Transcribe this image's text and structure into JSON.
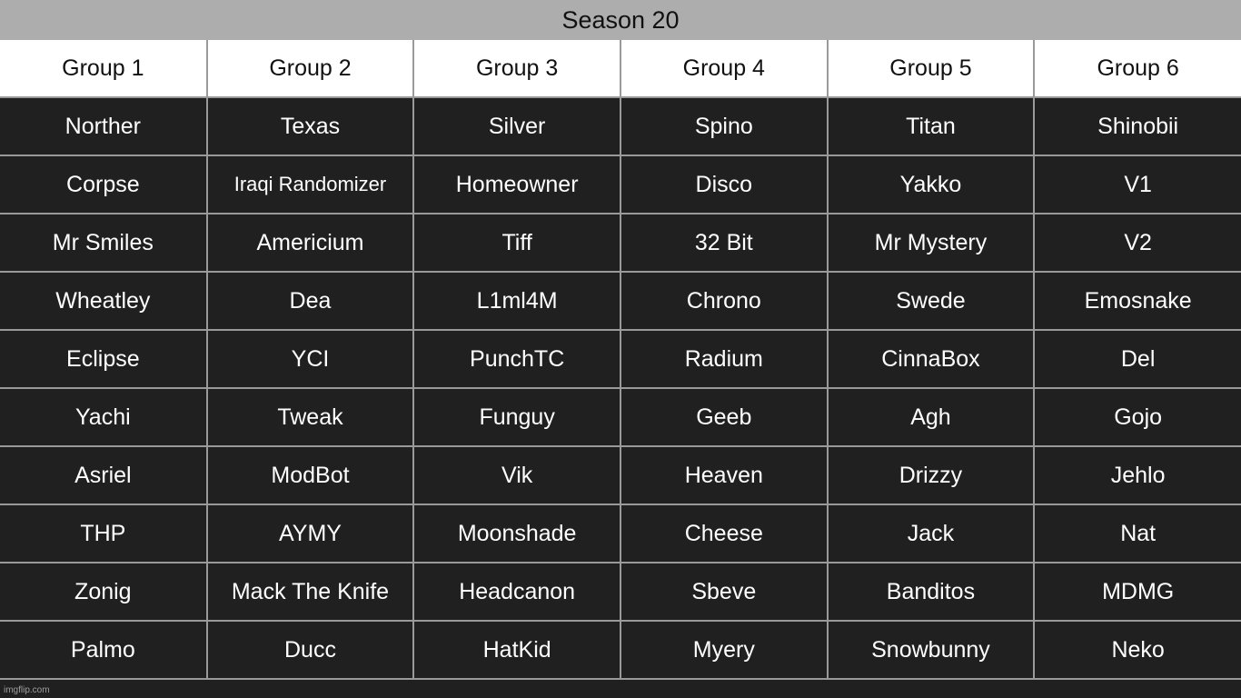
{
  "title": "Season 20",
  "headers": [
    "Group 1",
    "Group 2",
    "Group 3",
    "Group 4",
    "Group 5",
    "Group 6"
  ],
  "rows": [
    [
      "Norther",
      "Texas",
      "Silver",
      "Spino",
      "Titan",
      "Shinobii"
    ],
    [
      "Corpse",
      "Iraqi Randomizer",
      "Homeowner",
      "Disco",
      "Yakko",
      "V1"
    ],
    [
      "Mr Smiles",
      "Americium",
      "Tiff",
      "32 Bit",
      "Mr Mystery",
      "V2"
    ],
    [
      "Wheatley",
      "Dea",
      "L1ml4M",
      "Chrono",
      "Swede",
      "Emosnake"
    ],
    [
      "Eclipse",
      "YCI",
      "PunchTC",
      "Radium",
      "CinnaBox",
      "Del"
    ],
    [
      "Yachi",
      "Tweak",
      "Funguy",
      "Geeb",
      "Agh",
      "Gojo"
    ],
    [
      "Asriel",
      "ModBot",
      "Vik",
      "Heaven",
      "Drizzy",
      "Jehlo"
    ],
    [
      "THP",
      "AYMY",
      "Moonshade",
      "Cheese",
      "Jack",
      "Nat"
    ],
    [
      "Zonig",
      "Mack The Knife",
      "Headcanon",
      "Sbeve",
      "Banditos",
      "MDMG"
    ],
    [
      "Palmo",
      "Ducc",
      "HatKid",
      "Myery",
      "Snowbunny",
      "Neko"
    ]
  ],
  "watermark": "imgflip.com",
  "colors": {
    "title_bg": "#adadad",
    "header_bg": "#ffffff",
    "cell_bg": "#202020",
    "grid": "#9a9a9a"
  }
}
